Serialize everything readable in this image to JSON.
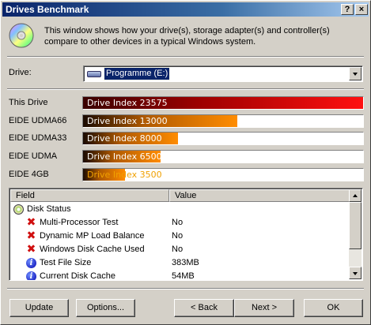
{
  "window": {
    "title": "Drives Benchmark",
    "help_button": "?",
    "close_button": "×"
  },
  "intro": {
    "text": "This window shows how your drive(s), storage adapter(s) and controller(s) compare to other devices in a typical Windows system.",
    "icon": "cd-disc-icon"
  },
  "drive": {
    "label": "Drive:",
    "selected": "Programme (E:)"
  },
  "benchmarks": [
    {
      "label": "This Drive",
      "text": "Drive Index 23575",
      "value": 23575,
      "style": "red"
    },
    {
      "label": "EIDE UDMA66",
      "text": "Drive Index 13000",
      "value": 13000,
      "style": "orange"
    },
    {
      "label": "EIDE UDMA33",
      "text": "Drive Index 8000",
      "value": 8000,
      "style": "orange"
    },
    {
      "label": "EIDE UDMA",
      "text": "Drive Index 6500",
      "value": 6500,
      "style": "orange"
    },
    {
      "label": "EIDE 4GB",
      "text": "Drive Index 3500",
      "value": 3500,
      "style": "orange"
    }
  ],
  "bench_max": 23575,
  "list": {
    "headers": {
      "field": "Field",
      "value": "Value"
    },
    "rows": [
      {
        "icon": "disk-status-icon",
        "field": "Disk Status",
        "value": "",
        "group": true
      },
      {
        "icon": "red-x-icon",
        "field": "Multi-Processor Test",
        "value": "No"
      },
      {
        "icon": "red-x-icon",
        "field": "Dynamic MP Load Balance",
        "value": "No"
      },
      {
        "icon": "red-x-icon",
        "field": "Windows Disk Cache Used",
        "value": "No"
      },
      {
        "icon": "info-icon",
        "field": "Test File Size",
        "value": "383MB"
      },
      {
        "icon": "info-icon",
        "field": "Current Disk Cache",
        "value": "54MB"
      }
    ]
  },
  "buttons": {
    "update": "Update",
    "options": "Options...",
    "back": "< Back",
    "next": "Next >",
    "ok": "OK"
  },
  "colors": {
    "title_start": "#0a246a",
    "bar_red": "#ff1010",
    "bar_orange": "#ff8c00"
  }
}
